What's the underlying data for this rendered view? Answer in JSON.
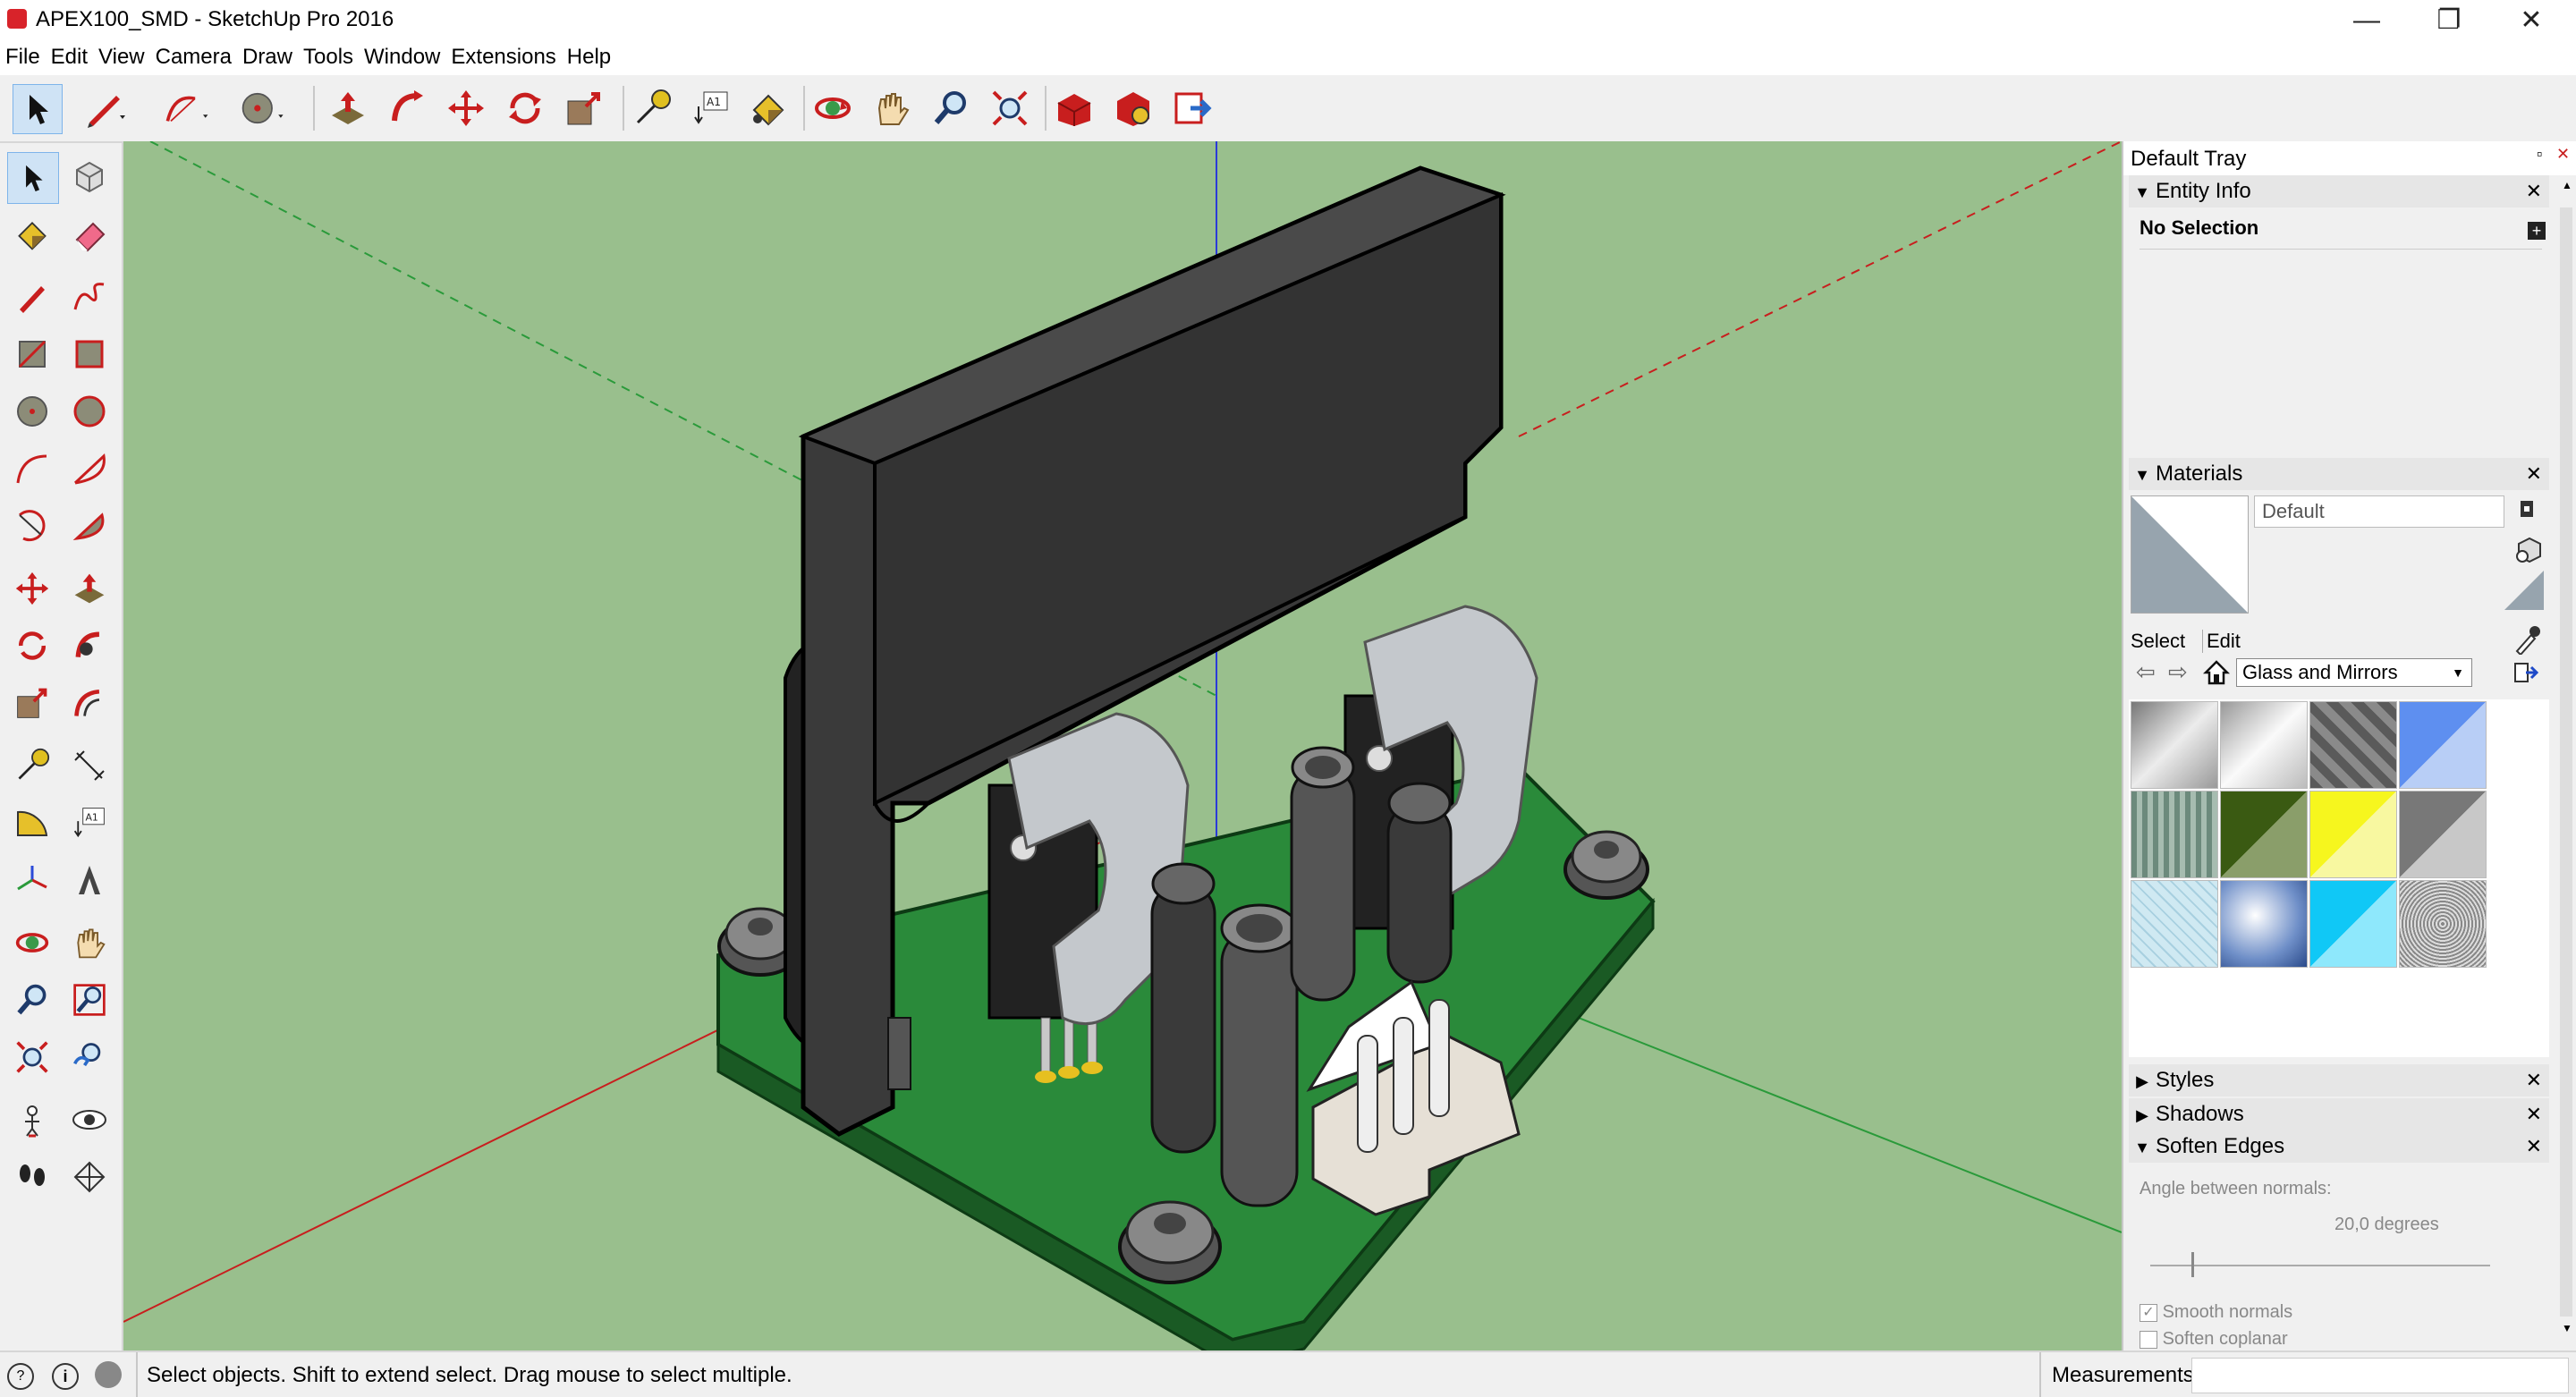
{
  "window": {
    "title": "APEX100_SMD - SketchUp Pro 2016",
    "minimize": "—",
    "restore": "❐",
    "close": "✕"
  },
  "menu": [
    "File",
    "Edit",
    "View",
    "Camera",
    "Draw",
    "Tools",
    "Window",
    "Extensions",
    "Help"
  ],
  "toolbar_icons": [
    "select-icon",
    "pencil-icon",
    "arc-icon",
    "circle-icon",
    "push-pull-icon",
    "follow-me-icon",
    "move-icon",
    "rotate-icon",
    "scale-icon",
    "tape-measure-icon",
    "text-icon",
    "paint-bucket-icon",
    "orbit-icon",
    "pan-icon",
    "zoom-icon",
    "zoom-extents-icon",
    "warehouse-icon",
    "extension-warehouse-icon",
    "send-to-layout-icon"
  ],
  "tray": {
    "title": "Default Tray",
    "entity_info": {
      "header": "Entity Info",
      "selection": "No Selection"
    },
    "materials": {
      "header": "Materials",
      "name_value": "Default",
      "tab_select": "Select",
      "tab_edit": "Edit",
      "library": "Glass and Mirrors",
      "swatch_colors": [
        "#c8c8c8",
        "#e6e6e6",
        "#6e6e6e",
        "#8eb4f4",
        "#8aa08a",
        "#4a6a1a",
        "#f4f41e",
        "#a0a0a0",
        "#cfe9f0",
        "#6f8fc8",
        "#1ed2f8",
        "#b8b8b8"
      ]
    },
    "styles": {
      "header": "Styles"
    },
    "shadows": {
      "header": "Shadows"
    },
    "soften_edges": {
      "header": "Soften Edges",
      "angle_label": "Angle between normals:",
      "angle_value": "20,0  degrees",
      "angle_fraction": 0.12,
      "smooth_normals": "Smooth normals",
      "soften_coplanar": "Soften coplanar"
    }
  },
  "status": {
    "message": "Select objects. Shift to extend select. Drag mouse to select multiple.",
    "measurements_label": "Measurements"
  },
  "colors": {
    "viewport_bg": "#99bf8d",
    "pcb": "#2a8a3a",
    "heatsink": "#3a3a3a",
    "accent_red": "#d8232a"
  }
}
